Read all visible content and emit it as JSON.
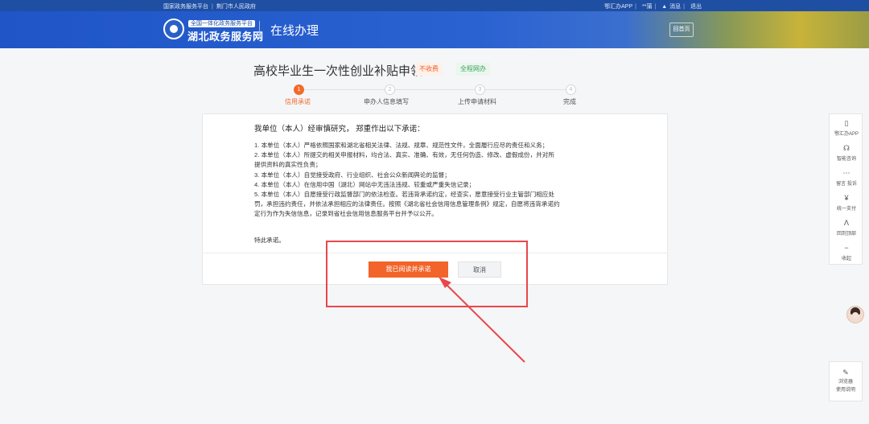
{
  "topbar": {
    "left_items": [
      "国家政务服务平台",
      "荆门市人民政府"
    ],
    "right_items": [
      "鄂汇办APP",
      "**蒲",
      "消息",
      "退出"
    ]
  },
  "header": {
    "logo_small": "全国一体化政务服务平台",
    "logo_main": "湖北政务服务网",
    "title": "在线办理",
    "home_button": "回首页"
  },
  "page": {
    "title": "高校毕业生一次性创业补贴申领",
    "badge_fee": "不收费",
    "badge_online": "全程网办"
  },
  "steps": [
    {
      "num": "1",
      "label": "信用承诺",
      "active": true
    },
    {
      "num": "2",
      "label": "申办人信息填写",
      "active": false
    },
    {
      "num": "3",
      "label": "上传申请材料",
      "active": false
    },
    {
      "num": "4",
      "label": "完成",
      "active": false
    }
  ],
  "promise": {
    "heading": "我单位（本人）经审慎研究， 郑重作出以下承诺：",
    "lines": [
      "1. 本单位（本人）严格依照国家和湖北省相关法律、法规、规章、规范性文件，全面履行应尽的责任和义务；",
      "2. 本单位（本人）所提交的相关申报材料，均合法、真实、准确、有效，无任何伪造、修改、虚假成份，并对所",
      "提供资料的真实性负责；",
      "3. 本单位（本人）自觉接受政府、行业组织、社会公众新闻舆论的监督；",
      "4. 本单位（本人）在信用中国（湖北）网站中无违法违规、较重或严重失信记录；",
      "5. 本单位（本人）自愿接受行政监督部门的依法检查。若违背承诺约定，经查实，愿意接受行业主管部门相应处",
      "罚，承担违约责任，并依法承担相应的法律责任。按照《湖北省社会信用信息管理条例》规定，自愿将违背承诺约",
      "定行为作为失信信息，记录到省社会信用信息服务平台并予以公开。"
    ],
    "closing": "特此承诺。"
  },
  "actions": {
    "confirm_label": "我已阅读并承诺",
    "cancel_label": "取消"
  },
  "sidebar": {
    "items": [
      {
        "icon": "phone-icon",
        "glyph": "▯",
        "label": "鄂汇办APP"
      },
      {
        "icon": "headset-icon",
        "glyph": "☊",
        "label": "智能咨询"
      },
      {
        "icon": "message-icon",
        "glyph": "⋯",
        "label": "留言 投诉"
      },
      {
        "icon": "yuan-icon",
        "glyph": "¥",
        "label": "统一支付"
      },
      {
        "icon": "back-to-top-icon",
        "glyph": "ᐱ",
        "label": "回到顶部"
      },
      {
        "icon": "collapse-icon",
        "glyph": "−",
        "label": "收起"
      }
    ],
    "browser_help": [
      "浏览器",
      "使用说明"
    ]
  },
  "colors": {
    "accent": "#f2642a",
    "header_blue": "#2a62d1",
    "annotation_red": "#e8474b"
  }
}
